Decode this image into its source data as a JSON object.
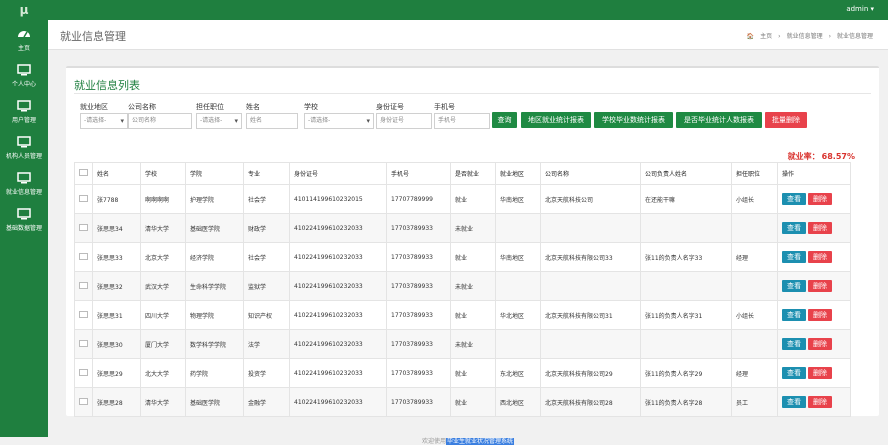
{
  "app": {
    "logo": "μ",
    "user": "admin ▾"
  },
  "sidebar": {
    "items": [
      {
        "label": "主页",
        "icon": "dashboard-icon"
      },
      {
        "label": "个人中心",
        "icon": "monitor-icon"
      },
      {
        "label": "用户管理",
        "icon": "monitor-icon"
      },
      {
        "label": "机构人员管理",
        "icon": "monitor-icon"
      },
      {
        "label": "就业信息管理",
        "icon": "monitor-icon"
      },
      {
        "label": "基础数据管理",
        "icon": "monitor-icon"
      }
    ]
  },
  "header": {
    "title": "就业信息管理",
    "crumbs": [
      "主页",
      "就业信息管理",
      "就业信息管理"
    ]
  },
  "panel": {
    "title": "就业信息列表"
  },
  "filters": [
    {
      "label": "就业地区",
      "value": "-请选择-",
      "select": true
    },
    {
      "label": "公司名称",
      "placeholder": "公司名称",
      "select": false
    },
    {
      "label": "担任职位",
      "value": "-请选择-",
      "select": true
    },
    {
      "label": "姓名",
      "placeholder": "姓名",
      "select": false
    },
    {
      "label": "学校",
      "value": "-请选择-",
      "select": true
    },
    {
      "label": "身份证号",
      "placeholder": "身份证号",
      "select": false
    },
    {
      "label": "手机号",
      "placeholder": "手机号",
      "select": false
    }
  ],
  "buttons": [
    {
      "label": "查询",
      "color": "green"
    },
    {
      "label": "地区就业统计报表",
      "color": "green"
    },
    {
      "label": "学校毕业数统计报表",
      "color": "green"
    },
    {
      "label": "是否毕业统计人数报表",
      "color": "green"
    },
    {
      "label": "批量删除",
      "color": "red"
    }
  ],
  "rate": {
    "label": "就业率：",
    "value": "68.57%"
  },
  "table": {
    "headers": [
      "姓名",
      "学校",
      "学院",
      "专业",
      "身份证号",
      "手机号",
      "是否就业",
      "就业地区",
      "公司名称",
      "公司负责人姓名",
      "担任职位",
      "操作"
    ],
    "view_label": "查看",
    "delete_label": "删除",
    "rows": [
      [
        "张7788",
        "啊啊啊啊",
        "护理学院",
        "社会学",
        "410114199610232015",
        "17707789999",
        "就业",
        "华南地区",
        "北京天航科技公司",
        "在还能干嘛",
        "小组长"
      ],
      [
        "张思思34",
        "清华大学",
        "基础医学院",
        "财政学",
        "410224199610232033",
        "17703789933",
        "未就业",
        "",
        "",
        "",
        ""
      ],
      [
        "张思思33",
        "北京大学",
        "经济学院",
        "社会学",
        "410224199610232033",
        "17703789933",
        "就业",
        "华南地区",
        "北京天航科技有限公司33",
        "张11的负责人名字33",
        "经理"
      ],
      [
        "张思思32",
        "武汉大学",
        "生命科学学院",
        "监狱学",
        "410224199610232033",
        "17703789933",
        "未就业",
        "",
        "",
        "",
        ""
      ],
      [
        "张思思31",
        "四川大学",
        "物理学院",
        "知识产权",
        "410224199610232033",
        "17703789933",
        "就业",
        "华北地区",
        "北京天航科技有限公司31",
        "张11的负责人名字31",
        "小组长"
      ],
      [
        "张思思30",
        "厦门大学",
        "数学科学学院",
        "法学",
        "410224199610232033",
        "17703789933",
        "未就业",
        "",
        "",
        "",
        ""
      ],
      [
        "张思思29",
        "北大大学",
        "药学院",
        "投资学",
        "410224199610232033",
        "17703789933",
        "就业",
        "东北地区",
        "北京天航科技有限公司29",
        "张11的负责人名字29",
        "经理"
      ],
      [
        "张思思28",
        "清华大学",
        "基础医学院",
        "金融学",
        "410224199610232033",
        "17703789933",
        "就业",
        "西北地区",
        "北京天航科技有限公司28",
        "张11的负责人名字28",
        "员工"
      ]
    ]
  },
  "footer": {
    "prefix": "欢迎使用",
    "system": "毕业生就业状况管理系统"
  }
}
